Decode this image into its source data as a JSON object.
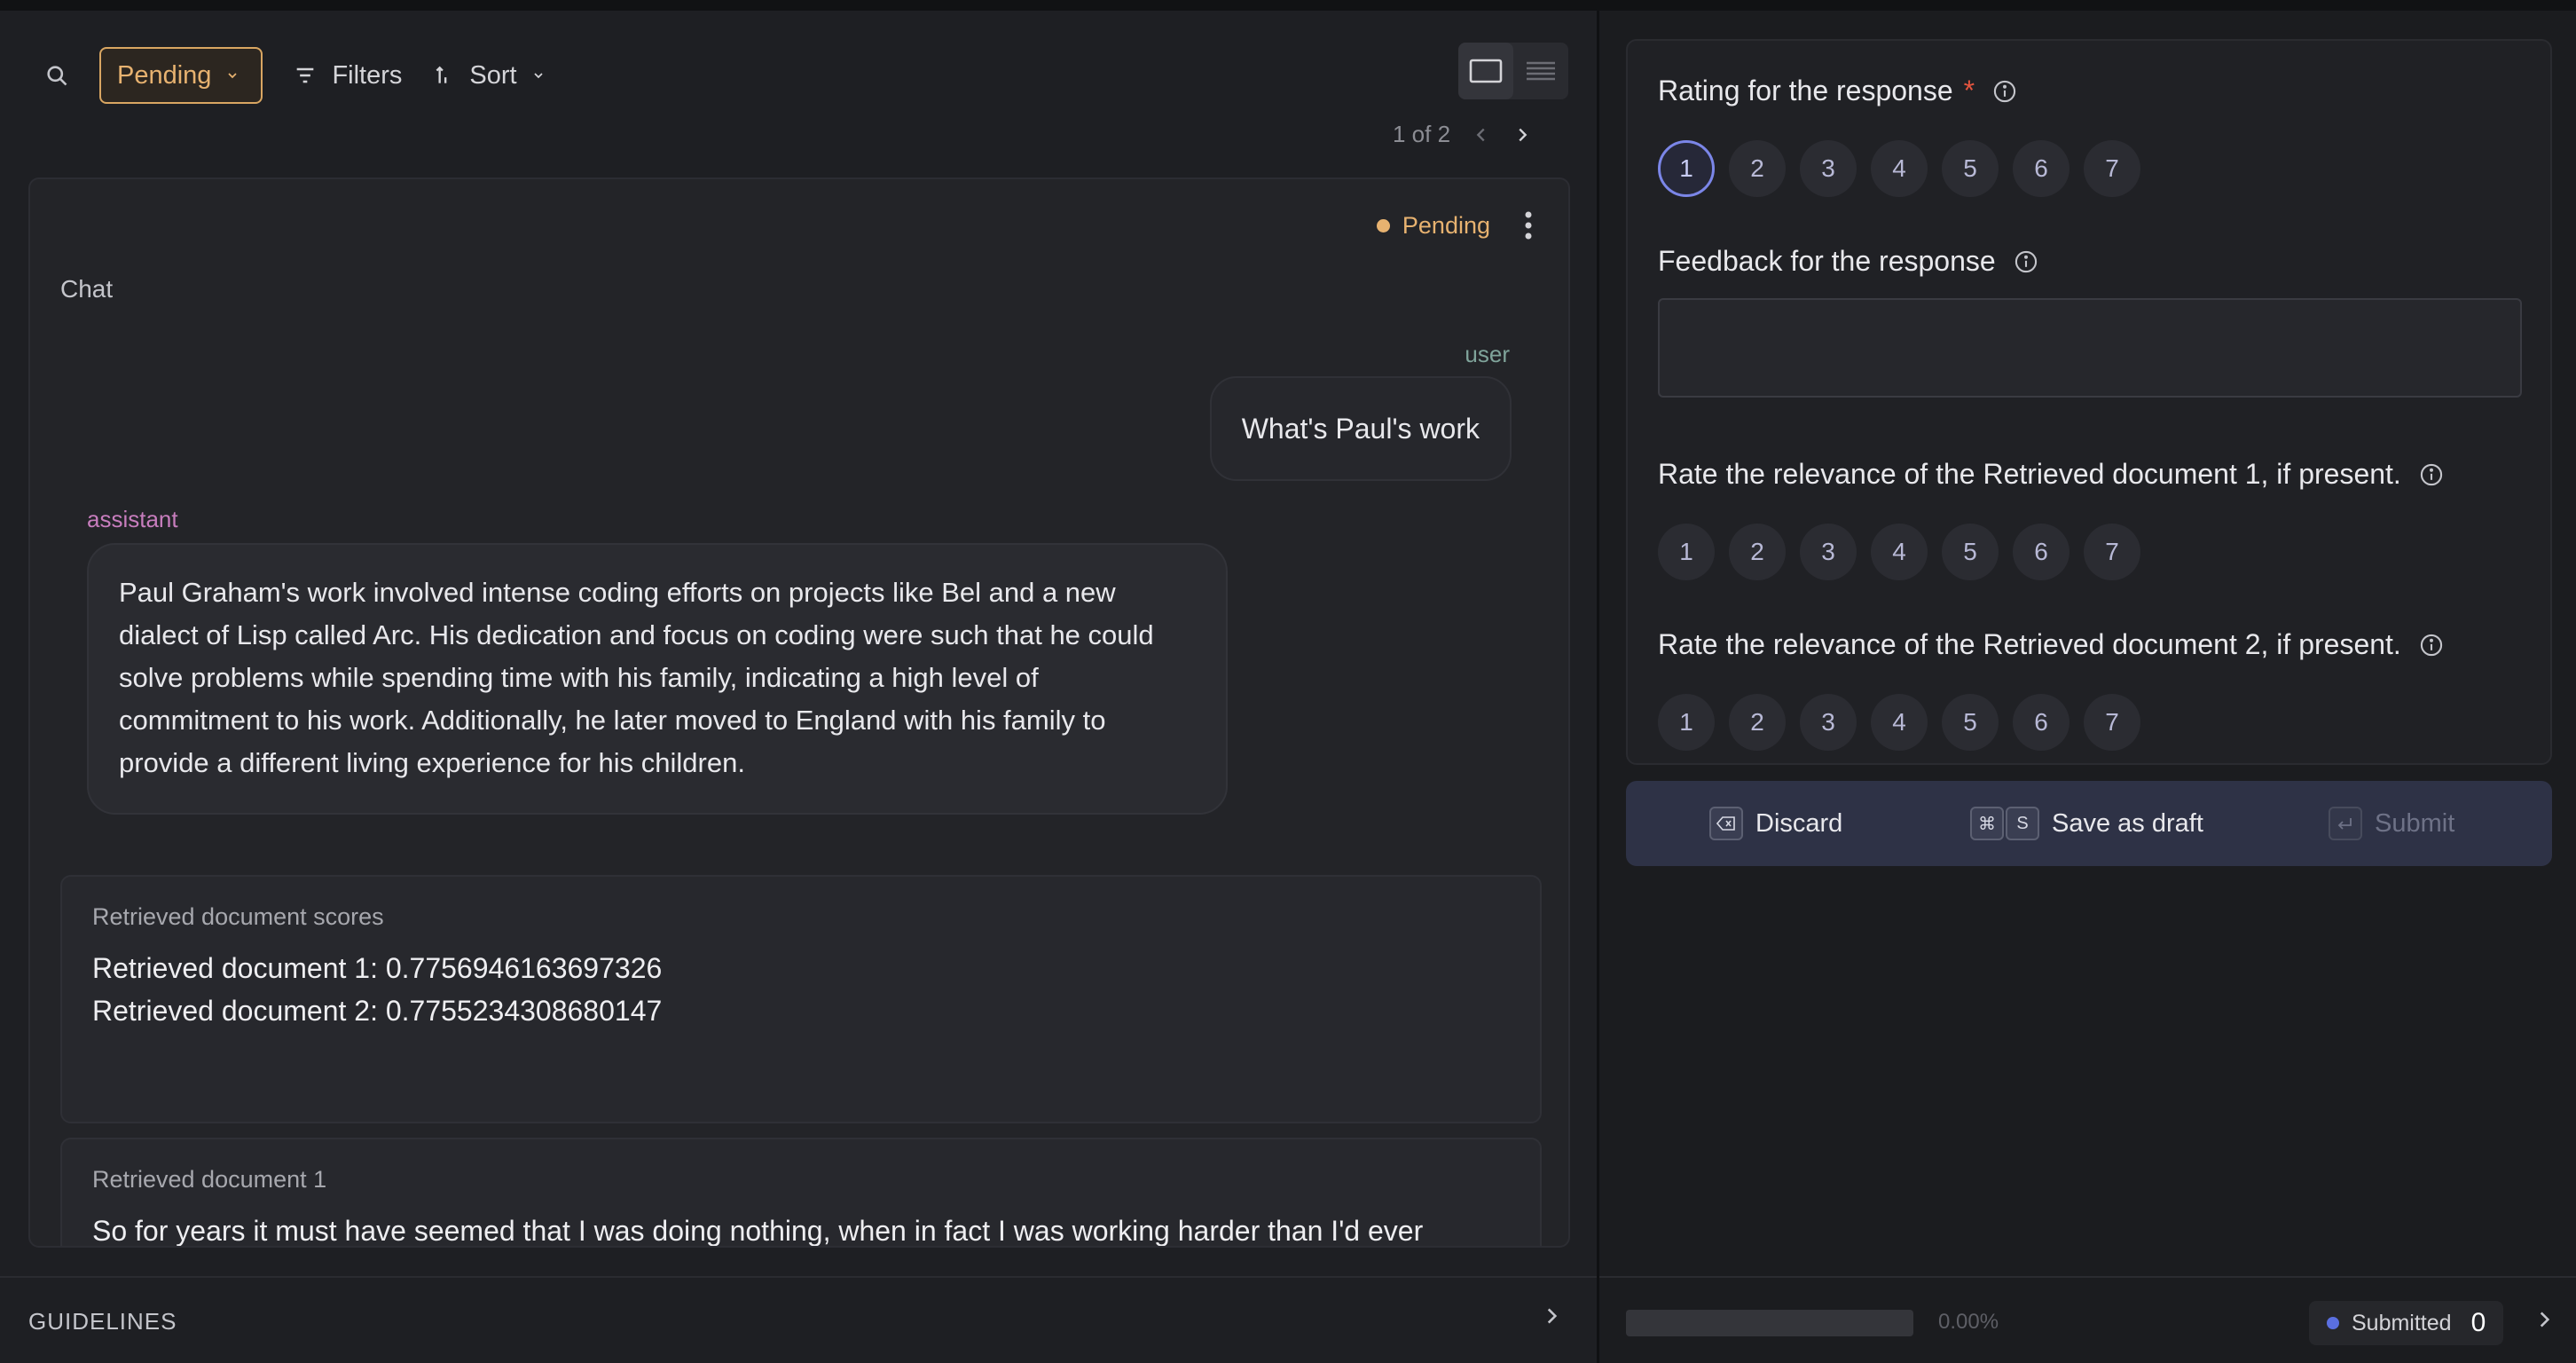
{
  "toolbar": {
    "search_icon": "search-icon",
    "status_filter": "Pending",
    "filters_label": "Filters",
    "sort_label": "Sort"
  },
  "pagination": {
    "text": "1 of 2"
  },
  "record": {
    "status": "Pending",
    "status_color": "#e7b270",
    "chat_field_label": "Chat",
    "messages": [
      {
        "role": "user",
        "content": "What's Paul's work"
      },
      {
        "role": "assistant",
        "content": "Paul Graham's work involved intense coding efforts on projects like Bel and a new dialect of Lisp called Arc. His dedication and focus on coding were such that he could solve problems while spending time with his family, indicating a high level of commitment to his work. Additionally, he later moved to England with his family to provide a different living experience for his children."
      }
    ],
    "scores_panel": {
      "title": "Retrieved document scores",
      "line1": "Retrieved document 1: 0.7756946163697326",
      "line2": "Retrieved document 2: 0.7755234308680147"
    },
    "doc1_panel": {
      "title": "Retrieved document 1",
      "text": "So for years it must have seemed that I was doing nothing, when in fact I was working harder than I'd ever"
    }
  },
  "guidelines": {
    "label": "GUIDELINES"
  },
  "form": {
    "questions": [
      {
        "label": "Rating for the response",
        "required_mark": "*",
        "options": [
          "1",
          "2",
          "3",
          "4",
          "5",
          "6",
          "7"
        ],
        "selected": "1"
      },
      {
        "label": "Feedback for the response",
        "value": ""
      },
      {
        "label": "Rate the relevance of the Retrieved document 1, if present.",
        "options": [
          "1",
          "2",
          "3",
          "4",
          "5",
          "6",
          "7"
        ]
      },
      {
        "label": "Rate the relevance of the Retrieved document 2, if present.",
        "options": [
          "1",
          "2",
          "3",
          "4",
          "5",
          "6",
          "7"
        ]
      }
    ],
    "actions": {
      "discard_label": "Discard",
      "save_kbd_1": "⌘",
      "save_kbd_2": "S",
      "save_label": "Save as draft",
      "submit_label": "Submit"
    }
  },
  "progress": {
    "percent": 0,
    "percent_text": "0.00%",
    "submitted_label": "Submitted",
    "submitted_count": "0",
    "accent_color": "#5a6fe0"
  }
}
